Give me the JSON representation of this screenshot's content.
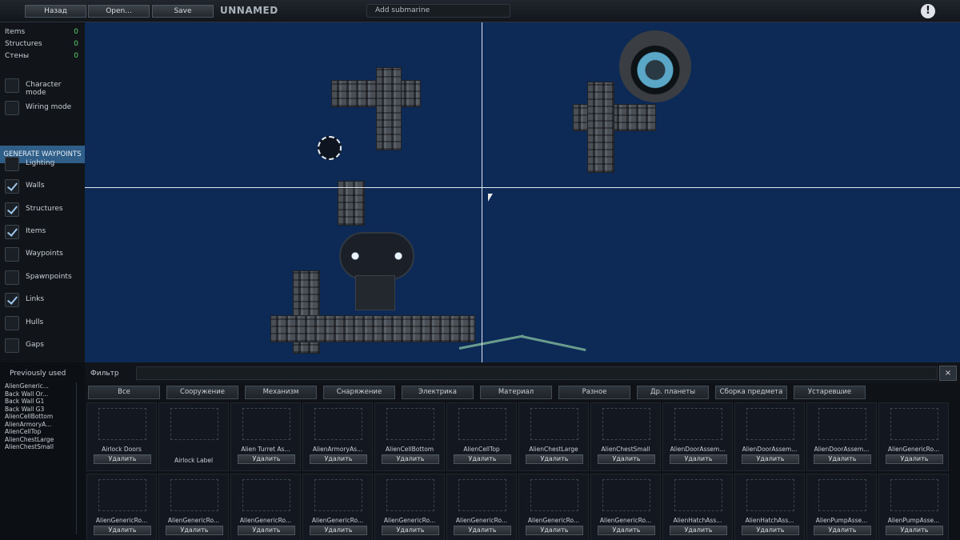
{
  "toolbar": {
    "back_label": "Назад",
    "open_label": "Open...",
    "save_label": "Save",
    "sub_name": "UNNAMED",
    "sub_field_value": "Add submarine"
  },
  "counts": [
    {
      "label": "Items",
      "value": "0"
    },
    {
      "label": "Structures",
      "value": "0"
    },
    {
      "label": "Стены",
      "value": "0"
    }
  ],
  "modes": [
    {
      "label": "Character mode",
      "checked": false
    },
    {
      "label": "Wiring mode",
      "checked": false
    }
  ],
  "generate_waypoints_label": "GENERATE WAYPOINTS",
  "visibility": [
    {
      "label": "Lighting",
      "checked": false
    },
    {
      "label": "Walls",
      "checked": true
    },
    {
      "label": "Structures",
      "checked": true
    },
    {
      "label": "Items",
      "checked": true
    },
    {
      "label": "Waypoints",
      "checked": false
    },
    {
      "label": "Spawnpoints",
      "checked": false
    },
    {
      "label": "Links",
      "checked": true
    },
    {
      "label": "Hulls",
      "checked": false
    },
    {
      "label": "Gaps",
      "checked": false
    }
  ],
  "previously_used": {
    "title": "Previously used",
    "items": [
      "AlienGeneric...",
      "Back Wall Or...",
      "Back Wall G1",
      "Back Wall G3",
      "AlienCellBottom",
      "AlienArmoryA...",
      "AlienCellTop",
      "AlienChestLarge",
      "AlienChestSmall"
    ]
  },
  "filter": {
    "label": "Фильтр",
    "value": "",
    "clear_label": "×"
  },
  "tabs": [
    "Все",
    "Сооружение",
    "Механизм",
    "Снаряжение",
    "Электрика",
    "Материал",
    "Разное",
    "Др. планеты",
    "Сборка предмета",
    "Устаревшие"
  ],
  "items_row1": [
    {
      "name": "Airlock Doors",
      "delete": "Удалить"
    },
    {
      "name": "Airlock Label",
      "delete": ""
    },
    {
      "name": "Alien Turret As...",
      "delete": "Удалить"
    },
    {
      "name": "AlienArmoryAs...",
      "delete": "Удалить"
    },
    {
      "name": "AlienCellBottom",
      "delete": "Удалить"
    },
    {
      "name": "AlienCellTop",
      "delete": "Удалить"
    },
    {
      "name": "AlienChestLarge",
      "delete": "Удалить"
    },
    {
      "name": "AlienChestSmall",
      "delete": "Удалить"
    },
    {
      "name": "AlienDoorAssem...",
      "delete": "Удалить"
    },
    {
      "name": "AlienDoorAssem...",
      "delete": "Удалить"
    },
    {
      "name": "AlienDoorAssem...",
      "delete": "Удалить"
    },
    {
      "name": "AlienGenericRo...",
      "delete": "Удалить"
    }
  ],
  "items_row2": [
    {
      "name": "AlienGenericRo...",
      "delete": "Удалить"
    },
    {
      "name": "AlienGenericRo...",
      "delete": "Удалить"
    },
    {
      "name": "AlienGenericRo...",
      "delete": "Удалить"
    },
    {
      "name": "AlienGenericRo...",
      "delete": "Удалить"
    },
    {
      "name": "AlienGenericRo...",
      "delete": "Удалить"
    },
    {
      "name": "AlienGenericRo...",
      "delete": "Удалить"
    },
    {
      "name": "AlienGenericRo...",
      "delete": "Удалить"
    },
    {
      "name": "AlienGenericRo...",
      "delete": "Удалить"
    },
    {
      "name": "AlienHatchAss...",
      "delete": "Удалить"
    },
    {
      "name": "AlienHatchAss...",
      "delete": "Удалить"
    },
    {
      "name": "AlienPumpAsse...",
      "delete": "Удалить"
    },
    {
      "name": "AlienPumpAsse...",
      "delete": "Удалить"
    }
  ],
  "colors": {
    "canvas": "#0d2a57",
    "accent": "#2f5e88",
    "count_green": "#5fcf6d"
  }
}
